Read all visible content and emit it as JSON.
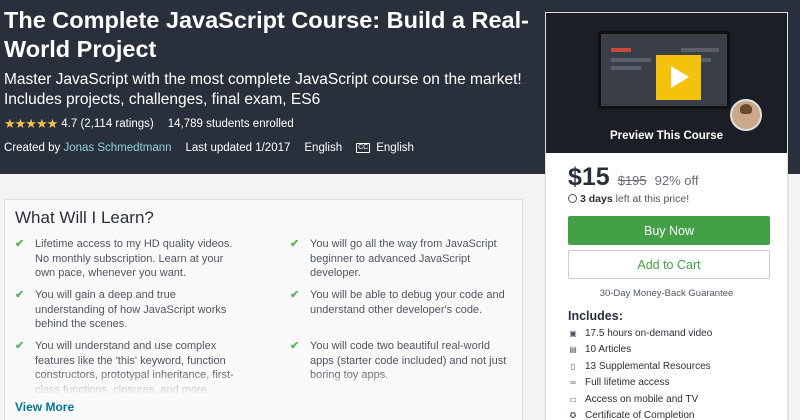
{
  "course": {
    "title": "The Complete JavaScript Course: Build a Real-World Project",
    "subtitle": "Master JavaScript with the most complete JavaScript course on the market! Includes projects, challenges, final exam, ES6",
    "stars": "★★★★★",
    "rating": "4.7 (2,114 ratings)",
    "enrolled": "14,789 students enrolled",
    "created_by_label": "Created by",
    "author": "Jonas Schmedtmann",
    "updated": "Last updated 1/2017",
    "language": "English",
    "cc_badge": "CC",
    "captions": "English"
  },
  "learn": {
    "heading": "What Will I Learn?",
    "items": [
      "Lifetime access to my HD quality videos. No monthly subscription. Learn at your own pace, whenever you want.",
      "You will go all the way from JavaScript beginner to advanced JavaScript developer.",
      "You will gain a deep and true understanding of how JavaScript works behind the scenes.",
      "You will be able to debug your code and understand other developer's code.",
      "You will understand and use complex features like the 'this' keyword, function constructors, prototypal inheritance, first-class functions, closures, and more.",
      "You will code two beautiful real-world apps (starter code included) and not just boring toy apps."
    ],
    "view_more": "View More"
  },
  "card": {
    "preview_label": "Preview This Course",
    "price": "$15",
    "original_price": "$195",
    "discount": "92% off",
    "timer_bold": "3 days",
    "timer_rest": " left at this price!",
    "buy_now": "Buy Now",
    "add_to_cart": "Add to Cart",
    "guarantee": "30-Day Money-Back Guarantee",
    "includes_title": "Includes:",
    "includes": [
      {
        "icon": "video-icon",
        "text": "17.5 hours on-demand video"
      },
      {
        "icon": "article-icon",
        "text": "10 Articles"
      },
      {
        "icon": "file-icon",
        "text": "13 Supplemental Resources"
      },
      {
        "icon": "infinity-icon",
        "text": "Full lifetime access"
      },
      {
        "icon": "mobile-icon",
        "text": "Access on mobile and TV"
      },
      {
        "icon": "certificate-icon",
        "text": "Certificate of Completion"
      }
    ]
  },
  "colors": {
    "hero_bg": "#29303b",
    "accent_link": "#007791",
    "buy_green": "#43a047",
    "star_gold": "#f4c150",
    "check_green": "#5bb55b"
  }
}
